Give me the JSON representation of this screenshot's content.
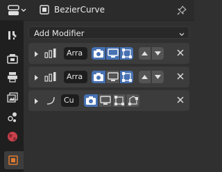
{
  "header": {
    "object_name": "BezierCurve",
    "editor_type_icon": "properties-editor-icon",
    "object_icon": "curve-object-icon",
    "pin_icon": "pin-icon"
  },
  "tabs": [
    {
      "icon": "tool-icon"
    },
    {
      "icon": "render-icon"
    },
    {
      "icon": "output-icon"
    },
    {
      "icon": "view-layer-icon"
    },
    {
      "icon": "scene-icon"
    },
    {
      "icon": "world-icon"
    },
    {
      "icon": "object-icon"
    }
  ],
  "add_modifier_label": "Add Modifier",
  "modifiers": [
    {
      "name": "Arra",
      "type_icon": "array-modifier-icon",
      "show_editmode": true,
      "show_viewport": true,
      "show_render": true,
      "show_on_cage": false
    },
    {
      "name": "Arra",
      "type_icon": "array-modifier-icon",
      "show_editmode": true,
      "show_viewport": false,
      "show_render": true,
      "show_on_cage": false
    },
    {
      "name": "Cu",
      "type_icon": "curve-modifier-icon",
      "show_editmode": true,
      "show_viewport": false,
      "show_render": false,
      "show_on_cage": false
    }
  ],
  "colors": {
    "accent": "#4772b3",
    "panel": "#3c3c3c",
    "background": "#303030"
  }
}
